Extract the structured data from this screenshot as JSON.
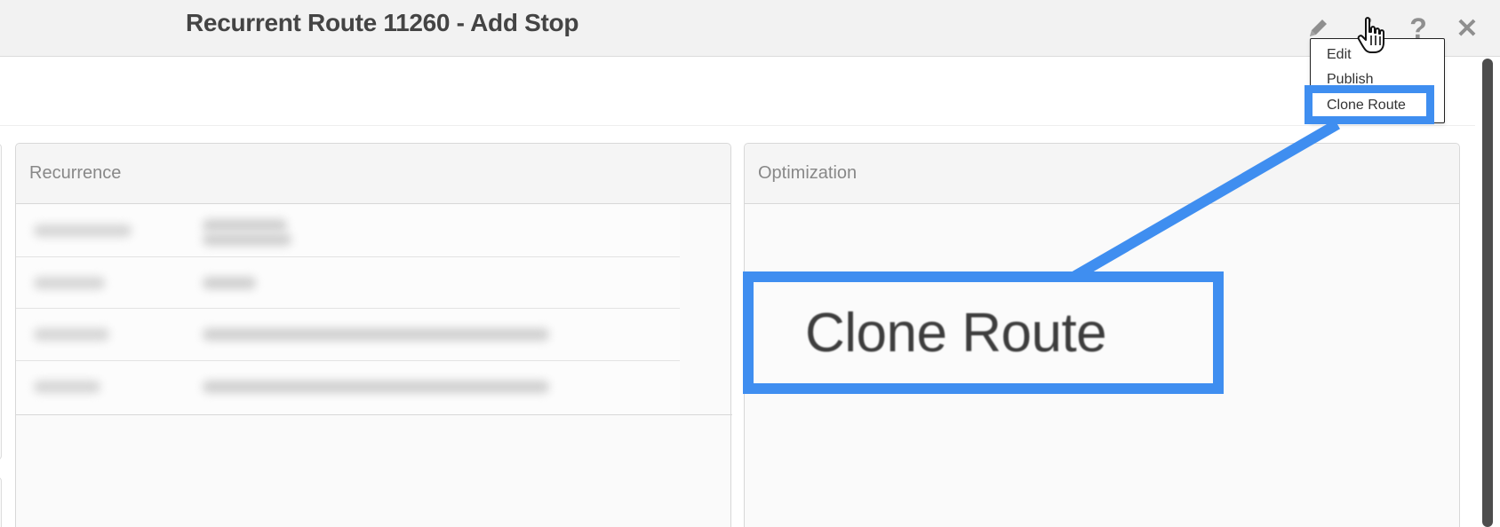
{
  "window": {
    "title": "Recurrent Route 11260 - Add Stop"
  },
  "header_icons": [
    {
      "name": "edit-pencil-icon"
    },
    {
      "name": "more-vertical-icon"
    },
    {
      "name": "help-icon",
      "glyph": "?"
    },
    {
      "name": "close-icon",
      "glyph": "✕"
    }
  ],
  "menu": {
    "items": [
      {
        "label": "Edit"
      },
      {
        "label": "Publish"
      },
      {
        "label": "Clone Route",
        "highlighted": true
      }
    ]
  },
  "panels": {
    "recurrence": {
      "title": "Recurrence",
      "row_count": 4,
      "content": "blurred"
    },
    "optimization": {
      "title": "Optimization"
    }
  },
  "callout": {
    "label": "Clone Route",
    "color": "#3f8ef0"
  },
  "colors": {
    "highlight": "#3f8ef0",
    "header_bg": "#f2f2f2",
    "icon": "#8f8f8f"
  }
}
